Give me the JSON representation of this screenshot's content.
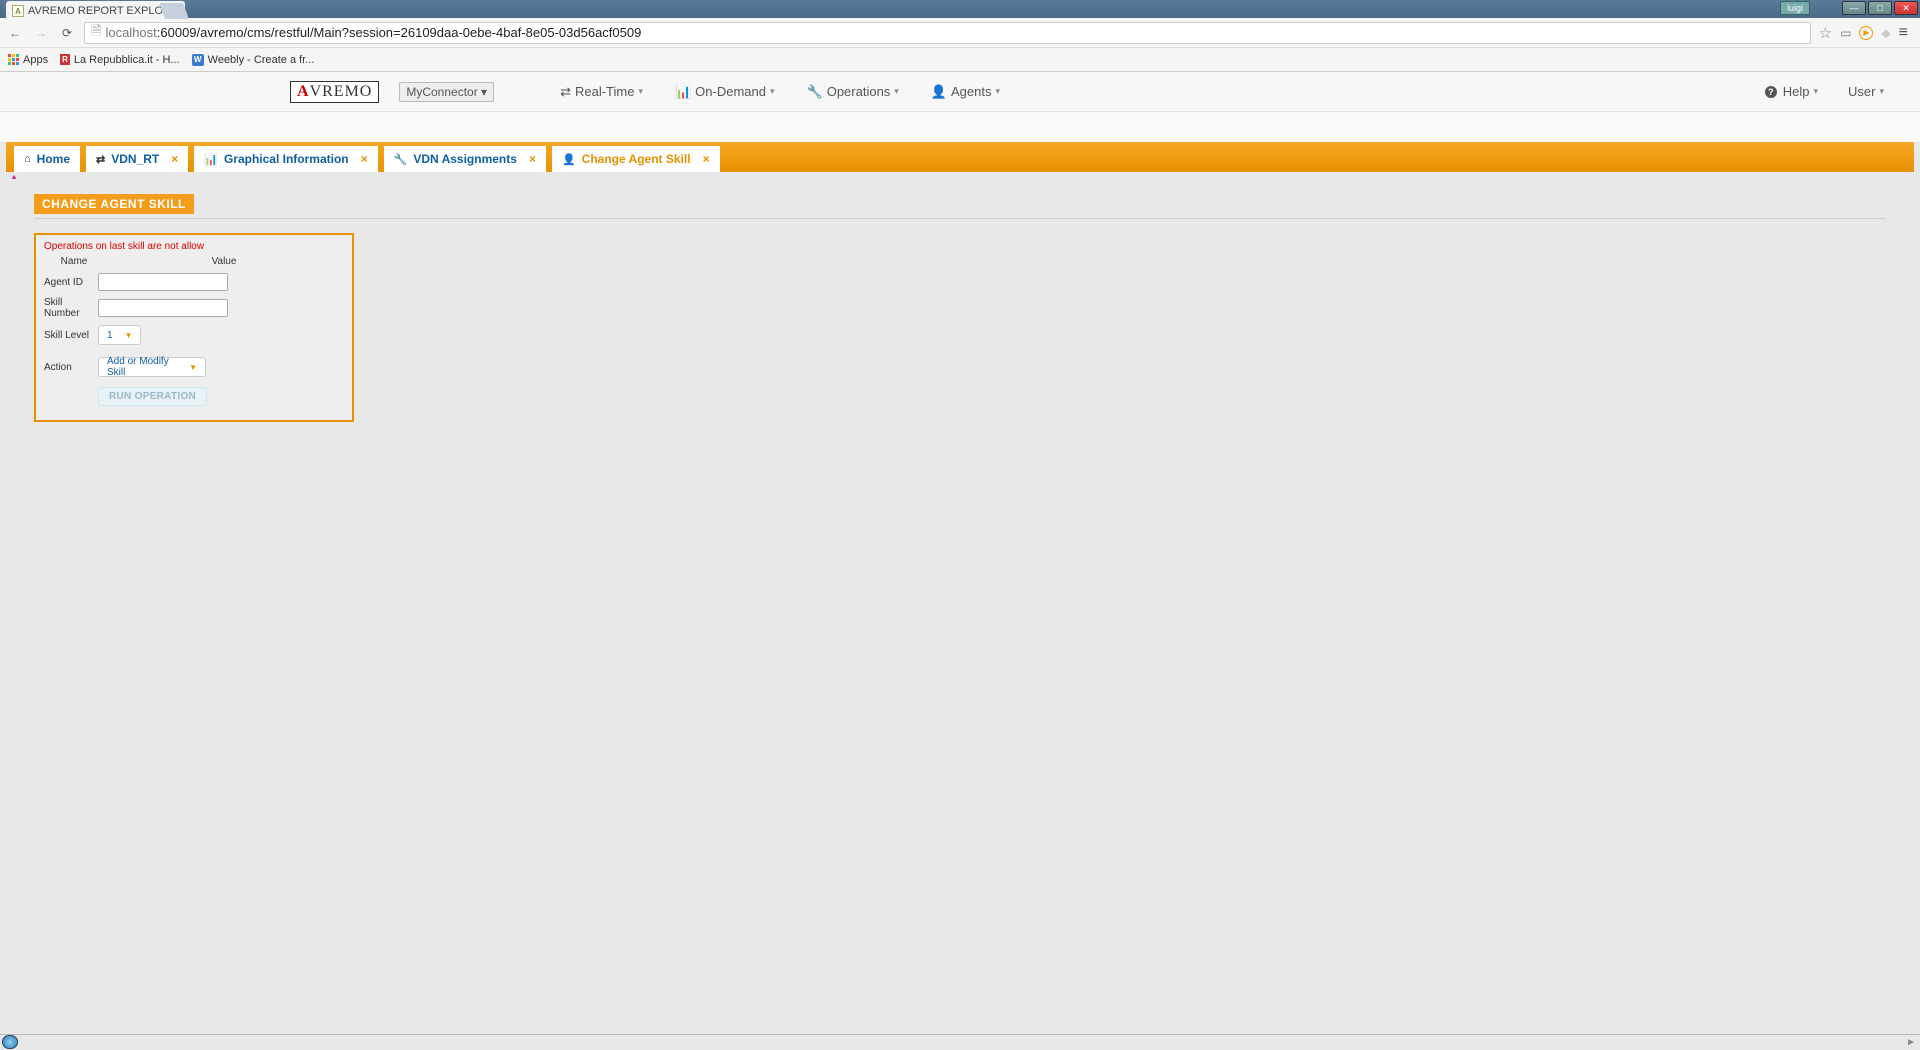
{
  "browser": {
    "tab_title": "AVREMO REPORT EXPLO",
    "url_host": "localhost",
    "url_port_path": ":60009/avremo/cms/restful/Main?session=26109daa-0ebe-4baf-8e05-03d56acf0509",
    "user_badge": "luigi",
    "bookmarks": {
      "apps": "Apps",
      "repubblica": "La Repubblica.it - H...",
      "weebly": "Weebly - Create a fr..."
    }
  },
  "app": {
    "logo_rest": "VREMO",
    "connector": "MyConnector ▾",
    "menu": {
      "realtime": "Real-Time",
      "ondemand": "On-Demand",
      "operations": "Operations",
      "agents": "Agents",
      "help": "Help",
      "user": "User"
    }
  },
  "tabs": [
    {
      "label": "Home"
    },
    {
      "label": "VDN_RT"
    },
    {
      "label": "Graphical Information"
    },
    {
      "label": "VDN Assignments"
    },
    {
      "label": "Change Agent Skill"
    }
  ],
  "page": {
    "title": "CHANGE AGENT SKILL",
    "warning": "Operations on last skill are not allow",
    "cols": {
      "name": "Name",
      "value": "Value"
    },
    "fields": {
      "agent_id": "Agent ID",
      "skill_number": "Skill Number",
      "skill_level": "Skill Level",
      "skill_level_val": "1",
      "action": "Action",
      "action_val": "Add or Modify Skill"
    },
    "run_btn": "RUN OPERATION"
  }
}
